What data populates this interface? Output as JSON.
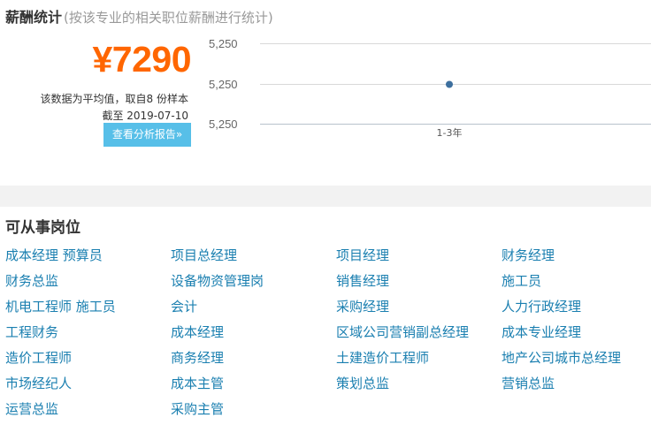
{
  "salary": {
    "title": "薪酬统计",
    "subtitle": "(按该专业的相关职位薪酬进行统计)",
    "amount": "¥7290",
    "note_line1": "该数据为平均值，取自8 份样本",
    "note_line2": "截至 2019-07-10",
    "report_button": "查看分析报告»"
  },
  "chart_data": {
    "type": "line",
    "categories": [
      "1-3年"
    ],
    "series": [
      {
        "values": [
          5250
        ]
      }
    ],
    "yticks": [
      "5,250",
      "5,250",
      "5,250"
    ],
    "grid": true,
    "colors": {
      "point": "#3d6f9e",
      "grid": "#d8d8d8"
    }
  },
  "jobs": {
    "title": "可从事岗位",
    "items": [
      "成本经理 预算员",
      "项目总经理",
      "项目经理",
      "财务经理",
      "财务总监",
      "设备物资管理岗",
      "销售经理",
      "施工员",
      "机电工程师 施工员",
      "会计",
      "采购经理",
      "人力行政经理",
      "工程财务",
      "成本经理",
      "区域公司营销副总经理",
      "成本专业经理",
      "造价工程师",
      "商务经理",
      "土建造价工程师",
      "地产公司城市总经理",
      "市场经纪人",
      "成本主管",
      "策划总监",
      "营销总监",
      "运营总监",
      "采购主管"
    ]
  }
}
